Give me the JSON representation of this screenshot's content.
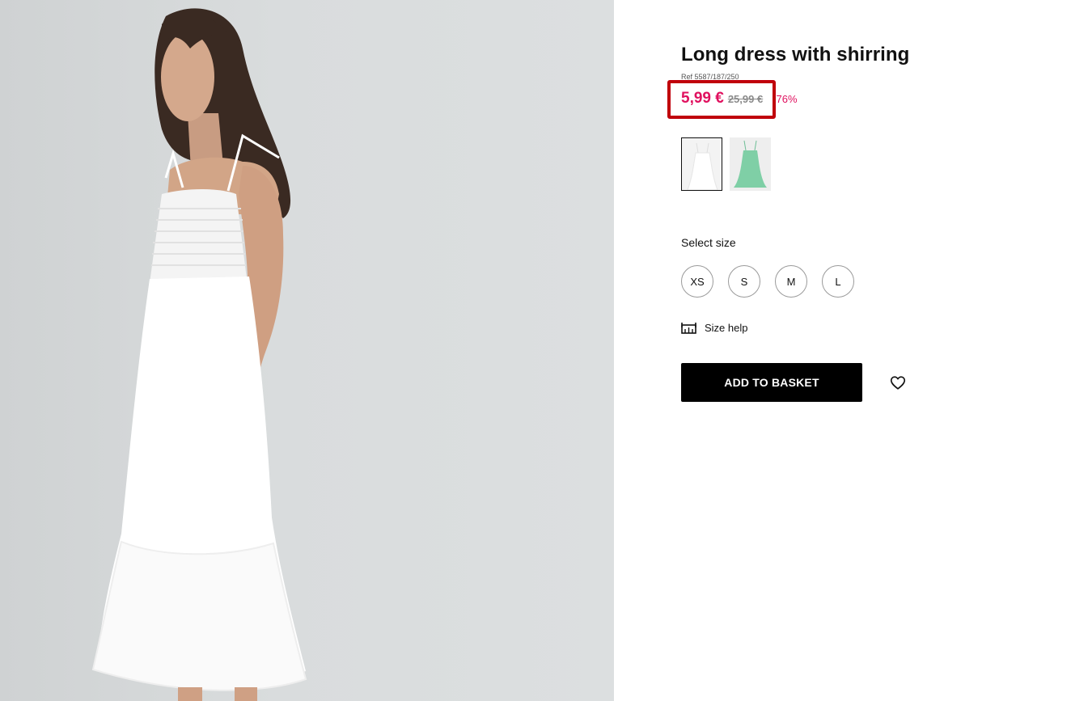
{
  "product": {
    "title": "Long dress with shirring",
    "ref": "Ref 5587/187/250",
    "price_current": "5,99 €",
    "price_old": "25,99 €",
    "discount": "-76%",
    "image_alt": "Model wearing white long dress with shirring",
    "colors": [
      {
        "name": "white",
        "hex": "#ffffff",
        "selected": true
      },
      {
        "name": "green",
        "hex": "#7fcfa6",
        "selected": false
      }
    ]
  },
  "size_selector": {
    "label": "Select size",
    "sizes": [
      "XS",
      "S",
      "M",
      "L"
    ]
  },
  "size_help": {
    "label": "Size help",
    "icon": "ruler-icon"
  },
  "actions": {
    "add_to_basket": "ADD TO BASKET",
    "wishlist_icon": "heart-icon"
  },
  "colors": {
    "accent_price": "#e0115f",
    "old_price": "#8a8a8a",
    "highlight": "#c0000b",
    "button_bg": "#000000"
  }
}
